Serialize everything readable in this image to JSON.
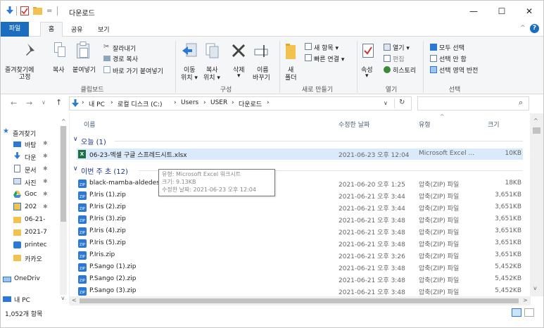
{
  "titlebar": {
    "title": "다운로드",
    "qa_sep": "=",
    "minimize": "—",
    "maximize": "☐",
    "close": "✕"
  },
  "tabs": {
    "file": "파일",
    "home": "홈",
    "share": "공유",
    "view": "보기",
    "help": "?"
  },
  "ribbon": {
    "clipboard": {
      "pin": "즐겨찾기에",
      "pin2": "고정",
      "copy": "복사",
      "paste": "붙여넣기",
      "cut": "잘라내기",
      "copy_path": "경로 복사",
      "paste_shortcut": "바로 가기 붙여넣기",
      "label": "클립보드"
    },
    "organize": {
      "move_to": "이동",
      "move_to2": "위치 ▾",
      "copy_to": "복사",
      "copy_to2": "위치 ▾",
      "delete": "삭제",
      "delete2": "▾",
      "rename": "이름",
      "rename2": "바꾸기",
      "label": "구성"
    },
    "new": {
      "new_folder": "새",
      "new_folder2": "폴더",
      "new_item": "새 항목 ▾",
      "easy_access": "빠른 연결 ▾",
      "label": "새로 만들기"
    },
    "open": {
      "properties": "속성",
      "properties2": "▾",
      "open": "열기 ▾",
      "edit": "편집",
      "history": "히스토리",
      "label": "열기"
    },
    "select": {
      "select_all": "모두 선택",
      "select_none": "선택 안 함",
      "invert": "선택 영역 반전",
      "label": "선택"
    }
  },
  "address": {
    "back": "←",
    "forward": "→",
    "recent": "∨",
    "up": "↑",
    "crumbs": [
      "내 PC",
      "로컬 디스크 (C:)",
      "Users",
      "USER",
      "다운로드"
    ],
    "sep": "›",
    "dropdown": "∨",
    "refresh": "↻",
    "search_placeholder": "",
    "search_icon": "⌕"
  },
  "nav": {
    "items": [
      "즐겨찾기",
      "바탕",
      "다운",
      "문서",
      "사진",
      "Goc",
      "202",
      "06-21-",
      "2021-7",
      "printec",
      "카카오",
      "OneDriv",
      "내 PC"
    ]
  },
  "columns": {
    "name": "이름",
    "modified": "수정한 날짜",
    "type": "유형",
    "size": "크기"
  },
  "groups": {
    "today": "오늘 (1)",
    "this_week": "이번 주 초 (12)"
  },
  "files": [
    {
      "name": "06-23-엑셀 구글 스프레드시트.xlsx",
      "date": "2021-06-23 오후 12:04",
      "type": "Microsoft Excel ...",
      "size": "10KB",
      "kind": "excel"
    },
    {
      "name": "black-mamba-aldedesign.zip",
      "date": "2021-06-20 오후 1:25",
      "type": "압축(ZIP) 파일",
      "size": "18KB",
      "kind": "zip"
    },
    {
      "name": "P.Iris (1).zip",
      "date": "2021-06-21 오후 3:44",
      "type": "압축(ZIP) 파일",
      "size": "3,651KB",
      "kind": "zip"
    },
    {
      "name": "P.Iris (2).zip",
      "date": "2021-06-21 오후 3:44",
      "type": "압축(ZIP) 파일",
      "size": "3,651KB",
      "kind": "zip"
    },
    {
      "name": "P.Iris (3).zip",
      "date": "2021-06-21 오후 3:48",
      "type": "압축(ZIP) 파일",
      "size": "3,651KB",
      "kind": "zip"
    },
    {
      "name": "P.Iris (4).zip",
      "date": "2021-06-21 오후 3:48",
      "type": "압축(ZIP) 파일",
      "size": "3,651KB",
      "kind": "zip"
    },
    {
      "name": "P.Iris (5).zip",
      "date": "2021-06-21 오후 3:48",
      "type": "압축(ZIP) 파일",
      "size": "3,651KB",
      "kind": "zip"
    },
    {
      "name": "P.Iris.zip",
      "date": "2021-06-21 오후 3:26",
      "type": "압축(ZIP) 파일",
      "size": "3,651KB",
      "kind": "zip"
    },
    {
      "name": "P.Sango (1).zip",
      "date": "2021-06-21 오후 3:48",
      "type": "압축(ZIP) 파일",
      "size": "5,452KB",
      "kind": "zip"
    },
    {
      "name": "P.Sango (2).zip",
      "date": "2021-06-21 오후 3:48",
      "type": "압축(ZIP) 파일",
      "size": "5,452KB",
      "kind": "zip"
    },
    {
      "name": "P.Sango (3).zip",
      "date": "2021-06-21 오후 3:48",
      "type": "압축(ZIP) 파일",
      "size": "5,452KB",
      "kind": "zip"
    }
  ],
  "tooltip": {
    "line1": "유형: Microsoft Excel 워크시트",
    "line2": "크기: 9.13KB",
    "line3": "수정한 날짜: 2021-06-23 오후 12:04"
  },
  "status": {
    "count": "1,052개 항목"
  },
  "colors": {
    "accent": "#1a6dbf",
    "selection": "#d9ebfa",
    "group_header": "#1e3287"
  }
}
